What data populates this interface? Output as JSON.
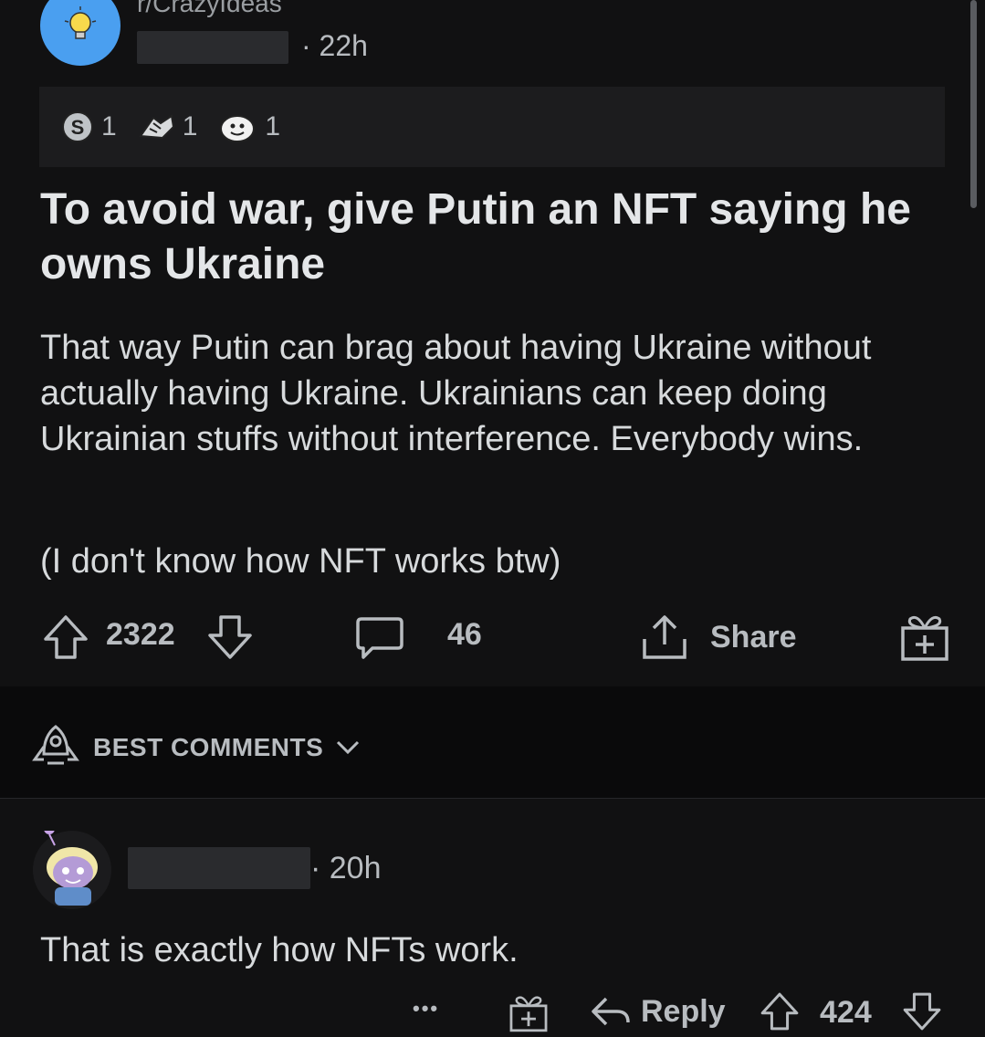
{
  "post": {
    "subreddit": "r/CrazyIdeas",
    "time": "· 22h",
    "awards": [
      {
        "icon": "silver-award-icon",
        "count": "1"
      },
      {
        "icon": "helpful-award-icon",
        "count": "1"
      },
      {
        "icon": "wholesome-award-icon",
        "count": "1"
      }
    ],
    "title": "To avoid war, give Putin an NFT saying he owns Ukraine",
    "body": "That way Putin can brag about having Ukraine without actually having Ukraine. Ukrainians can keep doing Ukrainian stuffs without interference. Everybody wins.",
    "aside": "(I don't know how NFT works btw)",
    "votes": "2322",
    "comments": "46",
    "share_label": "Share"
  },
  "sort": {
    "label": "BEST COMMENTS"
  },
  "comment": {
    "time": "· 20h",
    "text": "That is exactly how NFTs work.",
    "more": "•••",
    "reply_label": "Reply",
    "votes": "424"
  },
  "colors": {
    "background": "#111112",
    "subreddit_avatar": "#4a9ff0",
    "text": "#d7dadc",
    "muted": "#b8bcc0"
  }
}
